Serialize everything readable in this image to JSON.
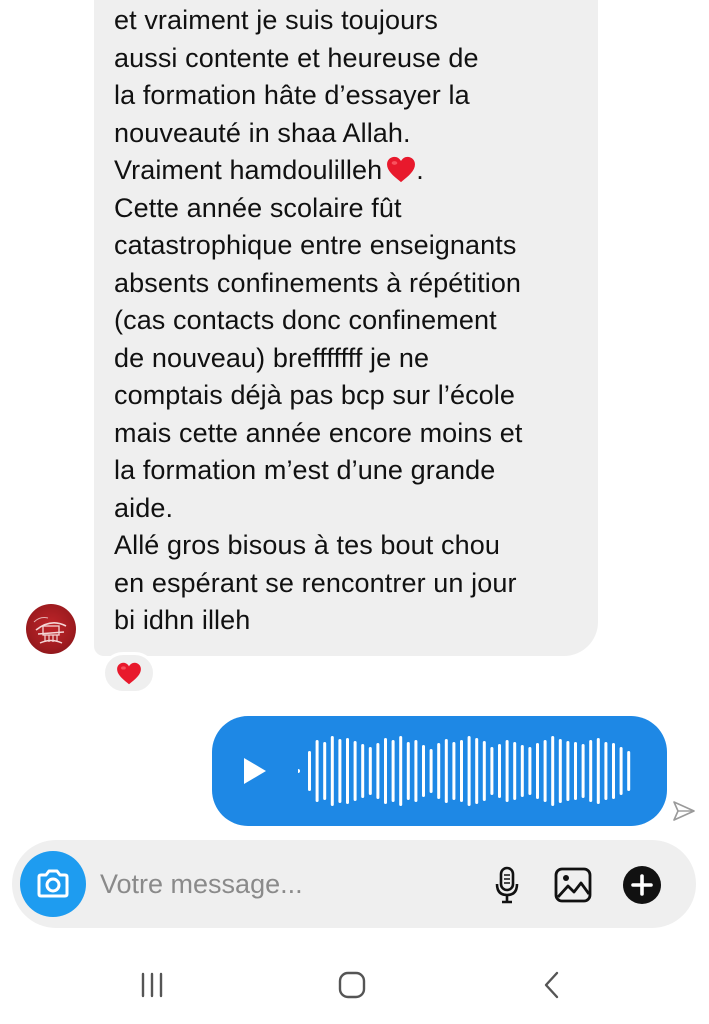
{
  "conversation": {
    "incoming_message": {
      "lines": [
        "et vraiment je suis toujours",
        "aussi contente et heureuse de",
        "la formation hâte d’essayer la",
        "nouveauté in  shaa Allah.",
        "Vraiment hamdoulilleh",
        "Cette année scolaire fût",
        "catastrophique entre enseignants",
        "absents confinements à répétition",
        "(cas contacts donc confinement",
        "de nouveau) brefffffff je ne",
        "comptais déjà pas bcp sur l’école",
        "mais cette année encore moins et",
        "la formation m’est d’une grande",
        "aide.",
        "Allé gros bisous à tes bout chou",
        "en espérant se rencontrer un jour",
        "bi idhn illeh"
      ],
      "line5_suffix": ".",
      "emoji": "heart-emoji",
      "reaction": "heart-emoji"
    },
    "outgoing_message": {
      "type": "voice",
      "play_icon": "play-icon"
    },
    "status_icon": "sent-icon"
  },
  "composer": {
    "placeholder": "Votre message...",
    "icons": [
      "camera-icon",
      "microphone-icon",
      "gallery-icon",
      "plus-icon"
    ]
  },
  "navigation": {
    "icons": [
      "recent-apps-icon",
      "home-icon",
      "back-icon"
    ]
  },
  "colors": {
    "incoming_bubble": "#efefef",
    "outgoing_bubble": "#1e88e5",
    "camera_button": "#1e9cf0",
    "heart": "#e8192c"
  }
}
